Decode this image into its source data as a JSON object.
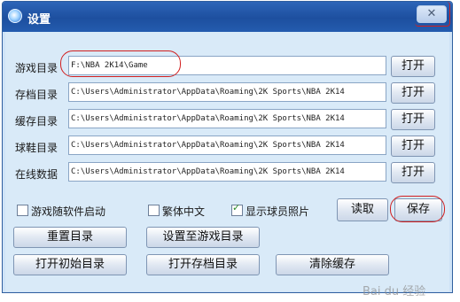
{
  "window": {
    "title": "设置",
    "close_symbol": "✕"
  },
  "rows": [
    {
      "label": "游戏目录",
      "path": "F:\\NBA 2K14\\Game",
      "button": "打开"
    },
    {
      "label": "存档目录",
      "path": "C:\\Users\\Administrator\\AppData\\Roaming\\2K Sports\\NBA 2K14",
      "button": "打开"
    },
    {
      "label": "缓存目录",
      "path": "C:\\Users\\Administrator\\AppData\\Roaming\\2K Sports\\NBA 2K14",
      "button": "打开"
    },
    {
      "label": "球鞋目录",
      "path": "C:\\Users\\Administrator\\AppData\\Roaming\\2K Sports\\NBA 2K14",
      "button": "打开"
    },
    {
      "label": "在线数据",
      "path": "C:\\Users\\Administrator\\AppData\\Roaming\\2K Sports\\NBA 2K14",
      "button": "打开"
    }
  ],
  "options": [
    {
      "label": "游戏随软件启动",
      "checked": false
    },
    {
      "label": "繁体中文",
      "checked": false
    },
    {
      "label": "显示球员照片",
      "checked": true
    }
  ],
  "buttons": {
    "read": "读取",
    "save": "保存",
    "reset_dirs": "重置目录",
    "set_to_game_dir": "设置至游戏目录",
    "open_initial_dir": "打开初始目录",
    "open_save_dir": "打开存档目录",
    "clear_cache": "清除缓存"
  },
  "watermark": "Bai du 经验"
}
